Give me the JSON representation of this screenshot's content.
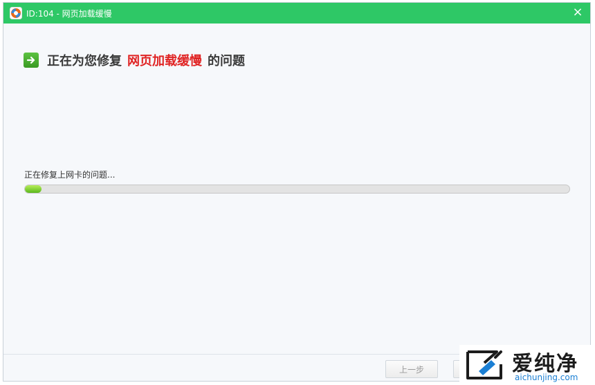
{
  "window": {
    "title": "ID:104 - 网页加载缓慢",
    "close_glyph": "×"
  },
  "heading": {
    "prefix": "正在为您修复",
    "highlight": "网页加载缓慢",
    "suffix": "的问题"
  },
  "status": {
    "text": "正在修复上网卡的问题...",
    "progress_percent": 3
  },
  "footer": {
    "prev_label": "上一步",
    "next_label": ""
  },
  "watermark": {
    "brand_cn": "爱纯净",
    "brand_en": "aichunjing.com"
  },
  "colors": {
    "titlebar": "#2ec866",
    "highlight": "#e02424",
    "progress": "#5ab81c",
    "watermark_link": "#1a7fd4"
  }
}
